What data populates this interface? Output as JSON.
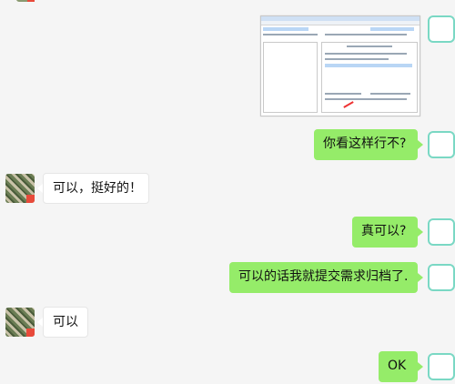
{
  "messages": [
    {
      "side": "right",
      "type": "image"
    },
    {
      "side": "right",
      "type": "text",
      "text": "你看这样行不?"
    },
    {
      "side": "left",
      "type": "text",
      "text": "可以，挺好的！"
    },
    {
      "side": "right",
      "type": "text",
      "text": "真可以?"
    },
    {
      "side": "right",
      "type": "text",
      "text": "可以的话我就提交需求归档了."
    },
    {
      "side": "left",
      "type": "text",
      "text": "可以"
    },
    {
      "side": "right",
      "type": "text",
      "text": "OK"
    }
  ],
  "colors": {
    "background": "#f5f5f5",
    "self_bubble": "#95ec69",
    "other_bubble": "#ffffff",
    "self_avatar_border": "#7ad8c4"
  }
}
